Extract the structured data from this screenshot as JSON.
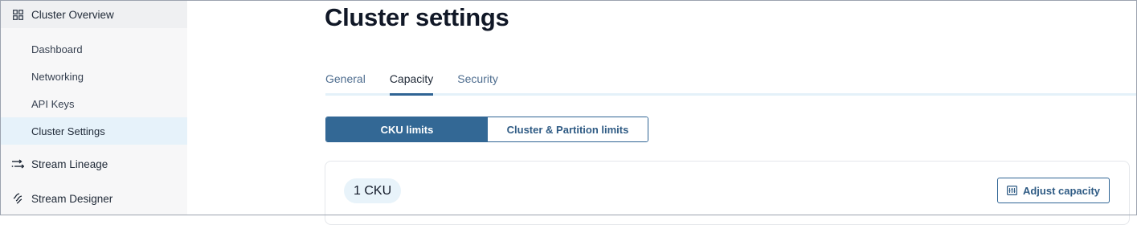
{
  "sidebar": {
    "groups": [
      {
        "label": "Cluster Overview",
        "icon": "grid-icon"
      },
      {
        "label": "Stream Lineage",
        "icon": "stream-lineage-icon"
      },
      {
        "label": "Stream Designer",
        "icon": "stream-designer-icon"
      }
    ],
    "items": [
      {
        "label": "Dashboard"
      },
      {
        "label": "Networking"
      },
      {
        "label": "API Keys"
      },
      {
        "label": "Cluster Settings",
        "active": true
      }
    ]
  },
  "main": {
    "title": "Cluster settings",
    "tabs": [
      {
        "label": "General"
      },
      {
        "label": "Capacity",
        "active": true
      },
      {
        "label": "Security"
      }
    ],
    "segments": [
      {
        "label": "CKU limits",
        "selected": true
      },
      {
        "label": "Cluster & Partition limits"
      }
    ],
    "card": {
      "badge": "1 CKU",
      "adjust_label": "Adjust capacity",
      "adjust_icon": "sliders-icon"
    }
  },
  "colors": {
    "accent": "#2f6494",
    "sidebar_bg": "#f7f7f8",
    "active_item_bg": "#e6f2fa",
    "tab_inactive": "#4e6d8f"
  }
}
